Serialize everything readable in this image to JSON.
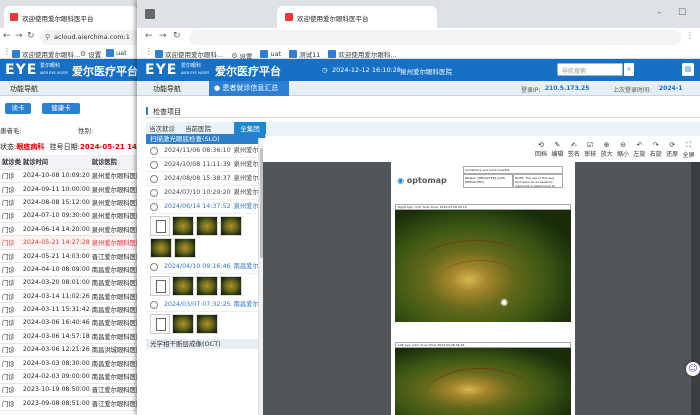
{
  "back_window": {
    "tab_title": "欢迎使用爱尔眼科医平台",
    "url": "acloud.aierchina.com:1",
    "bookmarks": [
      "欢迎使用爱尔眼科...",
      "设置",
      "uat"
    ],
    "brand_logo": "EYE",
    "brand_logo_cn": "爱尔眼科",
    "brand_logo_en": "AIER EYE HOSPITAL",
    "brand_title": "爱尔医疗平台",
    "nav_tab": "功能导航",
    "btn_read_card": "读卡",
    "btn_build_card": "健康卡",
    "label_patient": "患者毛:",
    "label_gender": "性别:",
    "status_label": "状态:",
    "status_value": "眼底病科",
    "registration_label": "挂号日期:",
    "registration_date": "2024-05-21 14:27",
    "list_columns": [
      "就诊类",
      "就诊时间",
      "就诊医院"
    ],
    "visits": [
      {
        "type": "门诊",
        "time": "2024-10-08 10:09:20",
        "hospital": "泉州爱尔眼科医院"
      },
      {
        "type": "门诊",
        "time": "2024-09-11 10:00:00",
        "hospital": "泉州爱尔眼科医院"
      },
      {
        "type": "门诊",
        "time": "2024-08-08 15:12:00",
        "hospital": "泉州爱尔眼科医院"
      },
      {
        "type": "门诊",
        "time": "2024-07-10 09:30:00",
        "hospital": "泉州爱尔眼科医院"
      },
      {
        "type": "门诊",
        "time": "2024-06-14 14:20:00",
        "hospital": "泉州爱尔眼科医院"
      },
      {
        "type": "门诊",
        "time": "2024-05-21 14:27:28",
        "hospital": "泉州爱尔眼科医院",
        "highlight": true
      },
      {
        "type": "门诊",
        "time": "2024-05-21 14:03:00",
        "hospital": "晋江爱尔眼科医院"
      },
      {
        "type": "门诊",
        "time": "2024-04-10 08:09:00",
        "hospital": "南昌爱尔眼科医院"
      },
      {
        "type": "门诊",
        "time": "2024-03-20 08:01:00",
        "hospital": "南昌爱尔眼科医院"
      },
      {
        "type": "门诊",
        "time": "2024-03-14 11:02:26",
        "hospital": "南昌爱尔眼科医院"
      },
      {
        "type": "门诊",
        "time": "2024-03-11 15:31:42",
        "hospital": "南昌爱尔眼科医院"
      },
      {
        "type": "门诊",
        "time": "2024-03-06 16:40:46",
        "hospital": "南昌爱尔眼科医院"
      },
      {
        "type": "门诊",
        "time": "2024-03-06 14:57:18",
        "hospital": "南昌爱尔眼科医院"
      },
      {
        "type": "门诊",
        "time": "2024-03-06 12:21:26",
        "hospital": "南昌洪城眼科医院"
      },
      {
        "type": "门诊",
        "time": "2024-03-03 08:30:00",
        "hospital": "南昌爱尔眼科医院"
      },
      {
        "type": "门诊",
        "time": "2024-02-03 09:00:00",
        "hospital": "南昌爱尔眼科医院"
      },
      {
        "type": "门诊",
        "time": "2023-10-19 08:50:00",
        "hospital": "晋江爱尔眼科医院"
      },
      {
        "type": "门诊",
        "time": "2023-09-08 08:51:00",
        "hospital": "晋江爱尔眼科医院"
      }
    ]
  },
  "front_window": {
    "tab_title": "欢迎使用爱尔眼科医平台",
    "url": "",
    "bookmarks": [
      "欢迎使用爱尔眼科...",
      "设置",
      "uat",
      "测试11",
      "欢迎使用爱尔眼科..."
    ],
    "brand_logo": "EYE",
    "brand_logo_cn": "爱尔眼科",
    "brand_logo_en": "AIER EYE HOSPITAL",
    "brand_title": "爱尔医疗平台",
    "datetime": "2024-12-12 16:10:28",
    "hospital": "泉州爱尔眼科医院",
    "search_placeholder": "导航搜索",
    "nav_tabs": [
      {
        "label": "功能导航",
        "active": false
      },
      {
        "label": "患者就诊信息汇总",
        "active": true
      }
    ],
    "login_ip_label": "登录IP:",
    "login_ip": "210.5.173.25",
    "last_login_label": "上次登录时间:",
    "last_login": "2024-1",
    "section_title": "检查项目",
    "sub_tabs": [
      {
        "label": "当次就诊",
        "active": false
      },
      {
        "label": "当前医院",
        "active": false
      },
      {
        "label": "全集团",
        "active": true
      }
    ],
    "slo_section": "扫描激光眼底检查(SLO)",
    "oct_section": "光学相干断层成像(OCT)",
    "records": [
      {
        "date": "2024/11/06 08:36:10",
        "hospital": "泉州爱尔",
        "blue": false
      },
      {
        "date": "2024/10/08 11:11:39",
        "hospital": "泉州爱尔",
        "blue": false
      },
      {
        "date": "2024/08/08 15:38:37",
        "hospital": "泉州爱尔",
        "blue": false
      },
      {
        "date": "2024/07/10 10:29:20",
        "hospital": "泉州爱尔",
        "blue": false
      },
      {
        "date": "2024/06/14 14:37:52",
        "hospital": "泉州爱尔",
        "blue": true
      }
    ],
    "records_2": [
      {
        "date": "2024/04/10 09:16:46",
        "hospital": "南昌爱尔",
        "blue": true
      }
    ],
    "records_3": [
      {
        "date": "2024/03/07 07:32:25",
        "hospital": "南昌爱尔",
        "blue": true
      }
    ],
    "viewer_tools": [
      "回档",
      "编辑",
      "签名",
      "审核",
      "放大",
      "缩小",
      "左旋",
      "右旋",
      "还原",
      "全屏"
    ],
    "report_logo": "optomap",
    "report_header": "Something and more hospital",
    "report_patient": "Patient: [REDACTED] (Left) [REDACTED]",
    "report_note": "NOTE: The use of this Aug technique as an assist to diagnosis is determined by the physician",
    "report_img1_caption": "Right eye: color",
    "report_img2_caption": "Left eye: color",
    "report_img_date": "Scan time: 2024-03-08 09:16"
  },
  "colors": {
    "brand_blue": "#1670c6",
    "accent_blue": "#2d7fd3",
    "alert_red": "#e00000"
  }
}
